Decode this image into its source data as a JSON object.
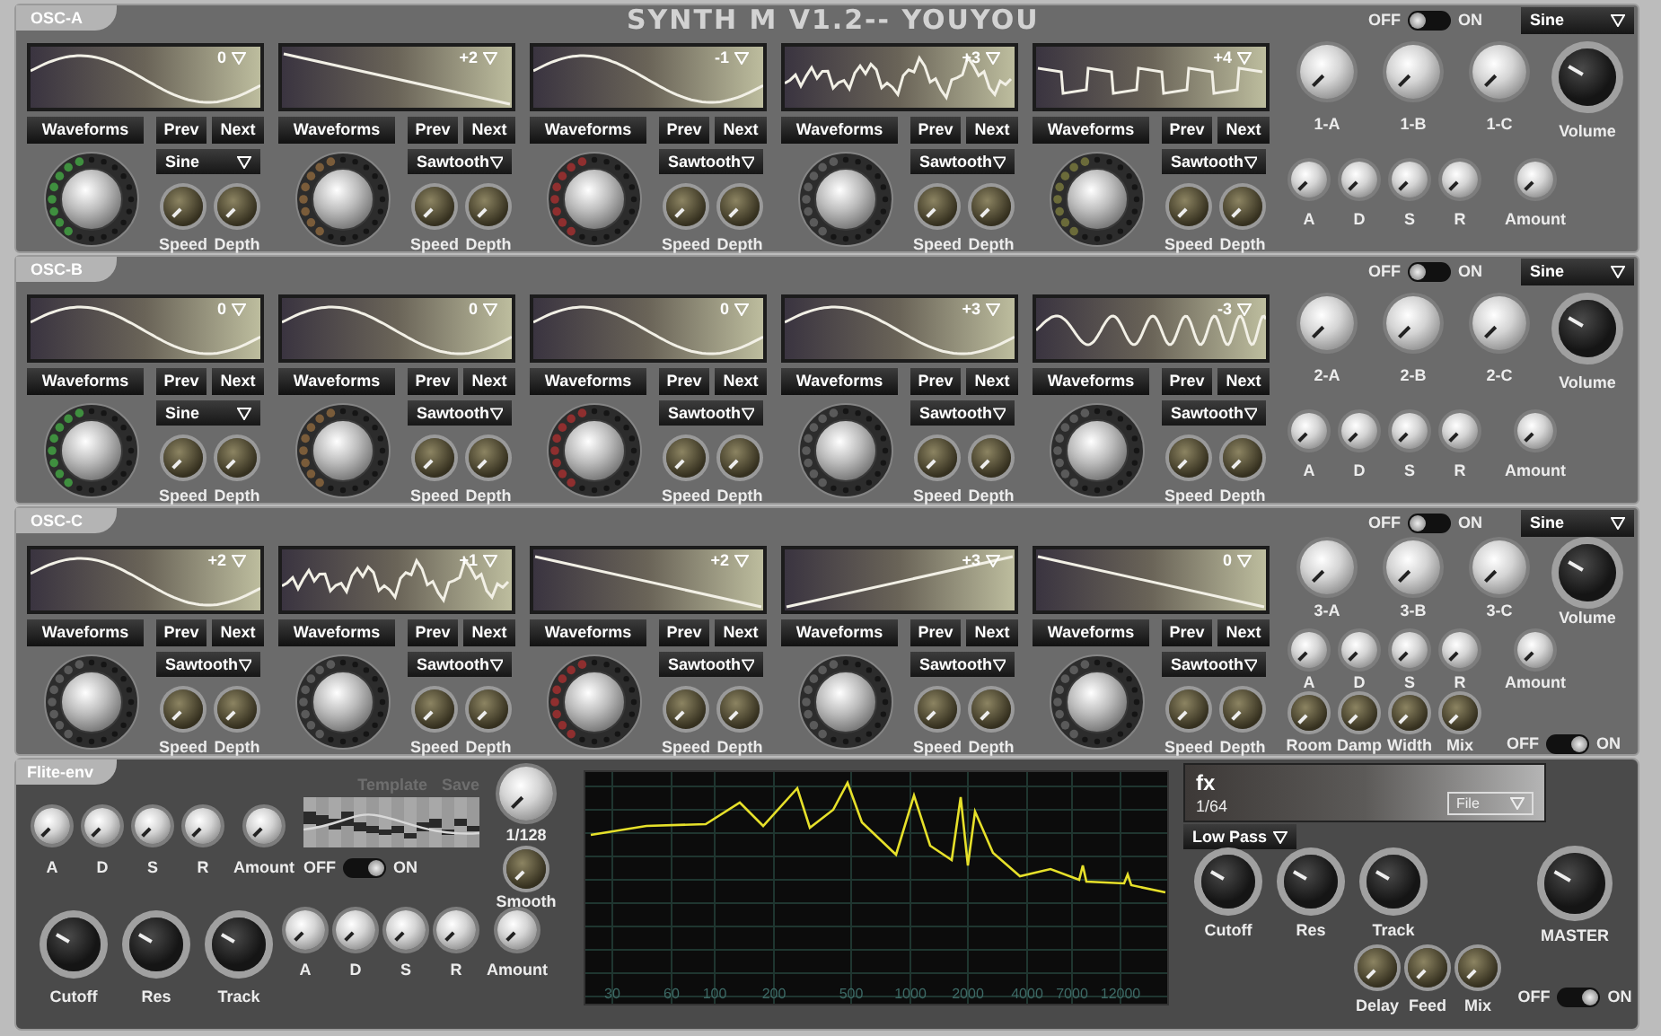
{
  "title": "SYNTH M V1.2-- YOUYOU",
  "oscillators": [
    {
      "tab": "OSC-A",
      "voices": [
        {
          "transpose": "0",
          "kind": "sine",
          "buttons": [
            "Waveforms",
            "Prev",
            "Next"
          ],
          "waveform": "Sine",
          "color": "#3f8f3f",
          "mod": [
            "Speed",
            "Depth"
          ]
        },
        {
          "transpose": "+2",
          "kind": "ramp_down",
          "buttons": [
            "Waveforms",
            "Prev",
            "Next"
          ],
          "waveform": "Sawtooth",
          "color": "#7a5c3a",
          "mod": [
            "Speed",
            "Depth"
          ]
        },
        {
          "transpose": "-1",
          "kind": "sine",
          "buttons": [
            "Waveforms",
            "Prev",
            "Next"
          ],
          "waveform": "Sawtooth",
          "color": "#8f2f2f",
          "mod": [
            "Speed",
            "Depth"
          ]
        },
        {
          "transpose": "+3",
          "kind": "noise",
          "buttons": [
            "Waveforms",
            "Prev",
            "Next"
          ],
          "waveform": "Sawtooth",
          "color": "#5a5a5a",
          "mod": [
            "Speed",
            "Depth"
          ]
        },
        {
          "transpose": "+4",
          "kind": "steps",
          "buttons": [
            "Waveforms",
            "Prev",
            "Next"
          ],
          "waveform": "Sawtooth",
          "color": "#6b6b3a",
          "mod": [
            "Speed",
            "Depth"
          ]
        }
      ],
      "power": {
        "off_label": "OFF",
        "on_label": "ON",
        "on": false
      },
      "shape": "Sine",
      "knobs": [
        {
          "label": "1-A",
          "kind": "silver"
        },
        {
          "label": "1-B",
          "kind": "silver"
        },
        {
          "label": "1-C",
          "kind": "silver"
        },
        {
          "label": "Volume",
          "kind": "dark"
        }
      ],
      "envelope": [
        "A",
        "D",
        "S",
        "R",
        "Amount"
      ]
    },
    {
      "tab": "OSC-B",
      "voices": [
        {
          "transpose": "0",
          "kind": "sine",
          "buttons": [
            "Waveforms",
            "Prev",
            "Next"
          ],
          "waveform": "Sine",
          "color": "#3f8f3f",
          "mod": [
            "Speed",
            "Depth"
          ]
        },
        {
          "transpose": "0",
          "kind": "sine",
          "buttons": [
            "Waveforms",
            "Prev",
            "Next"
          ],
          "waveform": "Sawtooth",
          "color": "#7a5c3a",
          "mod": [
            "Speed",
            "Depth"
          ]
        },
        {
          "transpose": "0",
          "kind": "sine",
          "buttons": [
            "Waveforms",
            "Prev",
            "Next"
          ],
          "waveform": "Sawtooth",
          "color": "#8f2f2f",
          "mod": [
            "Speed",
            "Depth"
          ]
        },
        {
          "transpose": "+3",
          "kind": "sine",
          "buttons": [
            "Waveforms",
            "Prev",
            "Next"
          ],
          "waveform": "Sawtooth",
          "color": "#5a5a5a",
          "mod": [
            "Speed",
            "Depth"
          ]
        },
        {
          "transpose": "-3",
          "kind": "wobble",
          "buttons": [
            "Waveforms",
            "Prev",
            "Next"
          ],
          "waveform": "Sawtooth",
          "color": "#5a5a5a",
          "mod": [
            "Speed",
            "Depth"
          ]
        }
      ],
      "power": {
        "off_label": "OFF",
        "on_label": "ON",
        "on": false
      },
      "shape": "Sine",
      "knobs": [
        {
          "label": "2-A",
          "kind": "silver"
        },
        {
          "label": "2-B",
          "kind": "silver"
        },
        {
          "label": "2-C",
          "kind": "silver"
        },
        {
          "label": "Volume",
          "kind": "dark"
        }
      ],
      "envelope": [
        "A",
        "D",
        "S",
        "R",
        "Amount"
      ]
    },
    {
      "tab": "OSC-C",
      "voices": [
        {
          "transpose": "+2",
          "kind": "sine",
          "buttons": [
            "Waveforms",
            "Prev",
            "Next"
          ],
          "waveform": "Sawtooth",
          "color": "#5a5a5a",
          "mod": [
            "Speed",
            "Depth"
          ]
        },
        {
          "transpose": "+1",
          "kind": "noise",
          "buttons": [
            "Waveforms",
            "Prev",
            "Next"
          ],
          "waveform": "Sawtooth",
          "color": "#5a5a5a",
          "mod": [
            "Speed",
            "Depth"
          ]
        },
        {
          "transpose": "+2",
          "kind": "ramp_down",
          "buttons": [
            "Waveforms",
            "Prev",
            "Next"
          ],
          "waveform": "Sawtooth",
          "color": "#8f2f2f",
          "mod": [
            "Speed",
            "Depth"
          ]
        },
        {
          "transpose": "+3",
          "kind": "ramp_up",
          "buttons": [
            "Waveforms",
            "Prev",
            "Next"
          ],
          "waveform": "Sawtooth",
          "color": "#5a5a5a",
          "mod": [
            "Speed",
            "Depth"
          ]
        },
        {
          "transpose": "0",
          "kind": "ramp_down",
          "buttons": [
            "Waveforms",
            "Prev",
            "Next"
          ],
          "waveform": "Sawtooth",
          "color": "#5a5a5a",
          "mod": [
            "Speed",
            "Depth"
          ]
        }
      ],
      "power": {
        "off_label": "OFF",
        "on_label": "ON",
        "on": false
      },
      "shape": "Sine",
      "knobs": [
        {
          "label": "3-A",
          "kind": "silver"
        },
        {
          "label": "3-B",
          "kind": "silver"
        },
        {
          "label": "3-C",
          "kind": "silver"
        },
        {
          "label": "Volume",
          "kind": "dark"
        }
      ],
      "envelope": [
        "A",
        "D",
        "S",
        "R",
        "Amount"
      ],
      "reverb": [
        "Room",
        "Damp",
        "Width",
        "Mix"
      ],
      "reverb_power": {
        "off_label": "OFF",
        "on_label": "ON",
        "on": true
      }
    }
  ],
  "filter_env": {
    "tab": "Flite-env",
    "envelope": [
      "A",
      "D",
      "S",
      "R",
      "Amount"
    ],
    "sequencer_labels": [
      "Template",
      "Save"
    ],
    "power": {
      "off_label": "OFF",
      "on_label": "ON",
      "on": true
    },
    "rate": "1/128",
    "smooth": "Smooth",
    "filter_knobs": [
      "Cutoff",
      "Res",
      "Track"
    ],
    "amp_envelope": [
      "A",
      "D",
      "S",
      "R",
      "Amount"
    ]
  },
  "spectrum": {
    "freq_labels": [
      "30",
      "60",
      "100",
      "200",
      "500",
      "1000",
      "2000",
      "4000",
      "7000",
      "12000"
    ]
  },
  "fx": {
    "title": "fx",
    "preset": "1/64",
    "file": "File",
    "filter_type": "Low Pass",
    "filter_knobs": [
      "Cutoff",
      "Res",
      "Track"
    ],
    "master": "MASTER",
    "delay_knobs": [
      "Delay",
      "Feed",
      "Mix"
    ],
    "power": {
      "off_label": "OFF",
      "on_label": "ON",
      "on": true
    }
  }
}
